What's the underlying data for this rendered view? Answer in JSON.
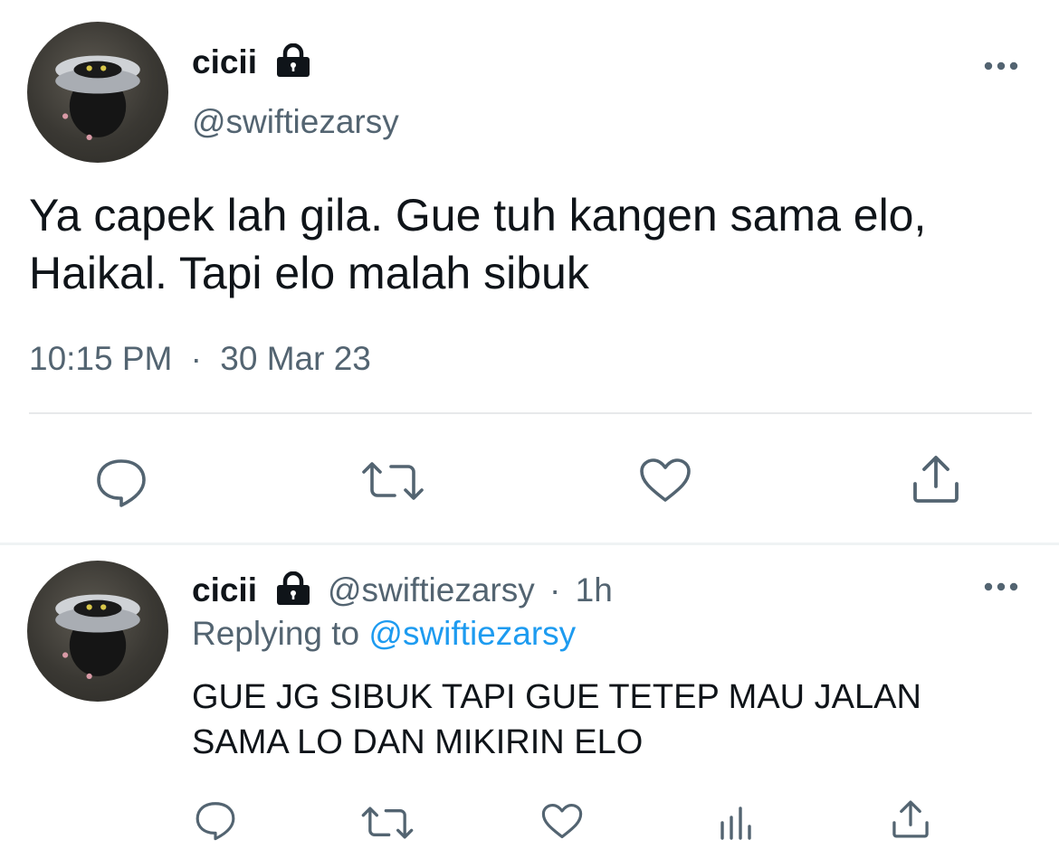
{
  "main_tweet": {
    "display_name": "cicii",
    "handle": "@swiftiezarsy",
    "text_line1": "Ya capek lah gila. Gue tuh kangen sama elo,",
    "text_line2": "Haikal. Tapi elo malah sibuk",
    "time": "10:15 PM",
    "separator": "·",
    "date": "30 Mar 23",
    "icons": [
      "lock-icon",
      "more-icon",
      "reply-icon",
      "retweet-icon",
      "like-icon",
      "share-icon"
    ]
  },
  "reply_tweet": {
    "display_name": "cicii",
    "handle": "@swiftiezarsy",
    "separator": "·",
    "time_ago": "1h",
    "replying_prefix": "Replying to",
    "replying_handle": "@swiftiezarsy",
    "text_line1": "GUE JG SIBUK TAPI GUE TETEP MAU JALAN",
    "text_line2": "SAMA LO DAN MIKIRIN ELO",
    "icons": [
      "lock-icon",
      "more-icon",
      "reply-icon",
      "retweet-icon",
      "like-icon",
      "analytics-icon",
      "share-icon"
    ]
  },
  "colors": {
    "text": "#0f1419",
    "secondary": "#536471",
    "link": "#1d9bf0",
    "divider": "#e7e9ea"
  }
}
